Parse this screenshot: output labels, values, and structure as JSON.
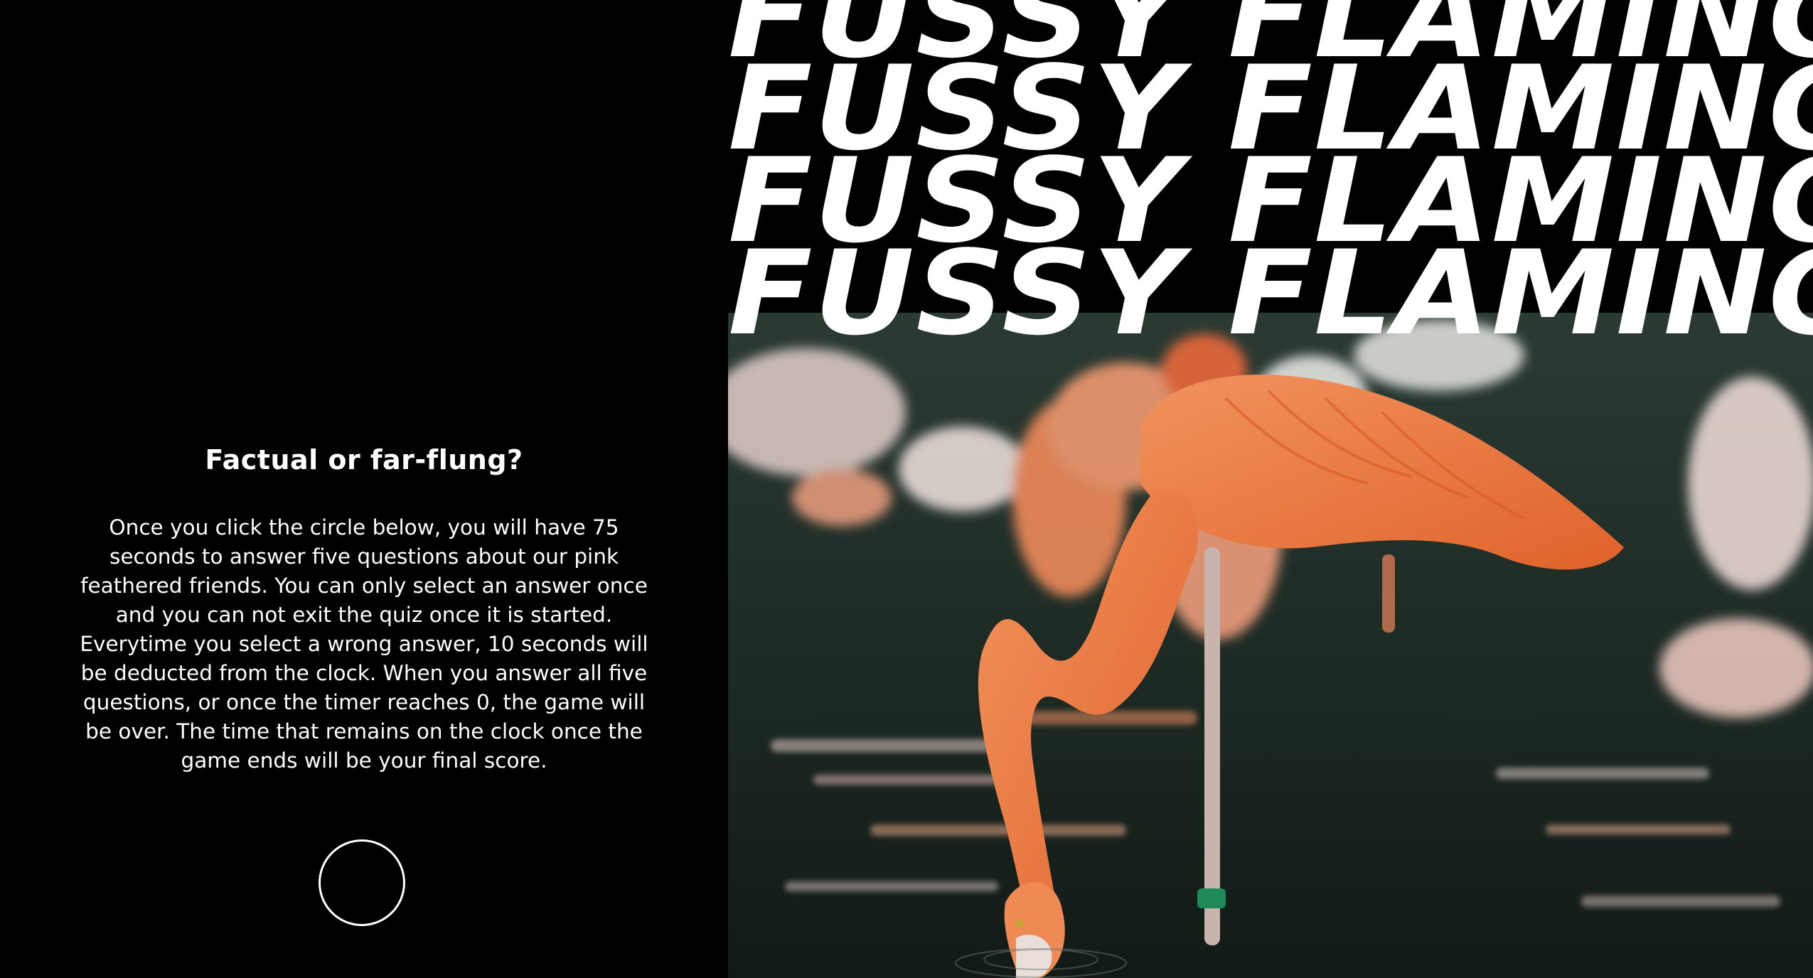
{
  "hero": {
    "title_lines": [
      "FUSSY FLAMINGO",
      "FUSSY FLAMINGO",
      "FUSSY FLAMINGO",
      "FUSSY FLAMINGO"
    ]
  },
  "intro": {
    "heading": "Factual or far-flung?",
    "description": "Once you click the circle below, you will have 75 seconds to answer five questions about our pink feathered friends. You can only select an answer once and you can not exit the quiz once it is started. Everytime you select a wrong answer, 10 seconds will be deducted from the clock. When you answer all five questions, or once the timer reaches 0, the game will be over. The time that remains on the clock once the game ends will be your final score.",
    "start_button_icon": "circle-outline"
  },
  "colors": {
    "background": "#000000",
    "text": "#ffffff",
    "flamingo": "#f07a42",
    "water": "#1c2a24"
  }
}
